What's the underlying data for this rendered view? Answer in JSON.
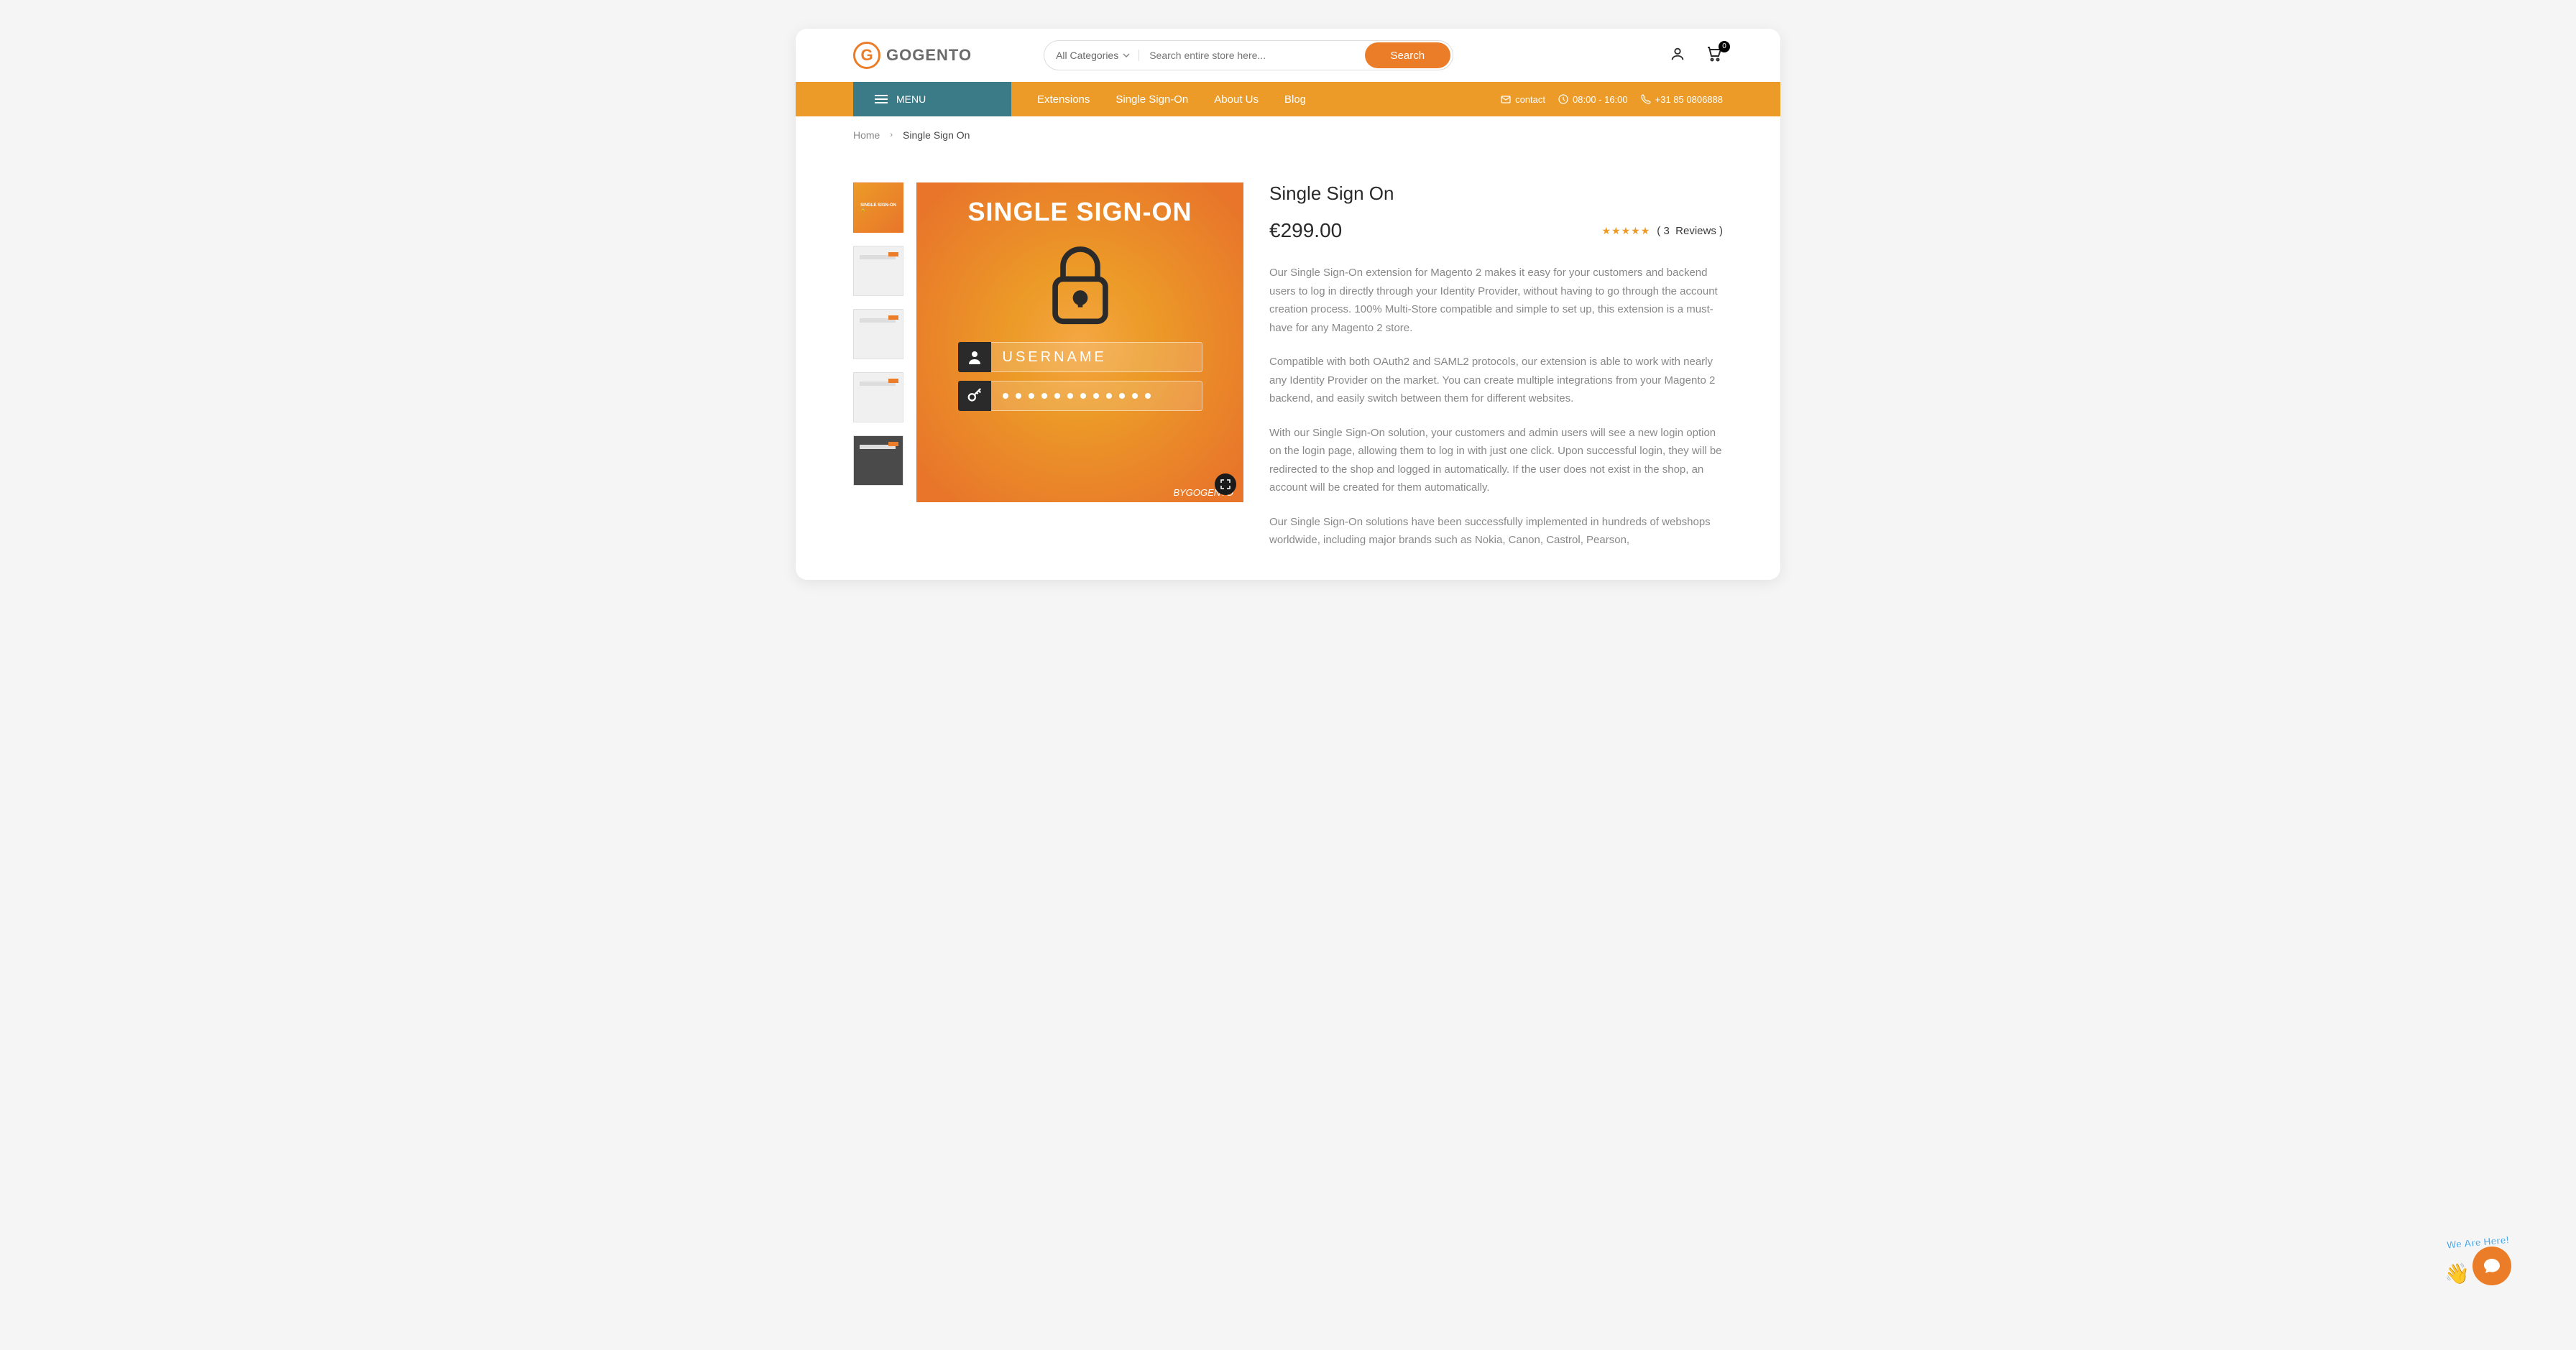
{
  "brand": {
    "name": "GOGENTO"
  },
  "header": {
    "search_category": "All Categories",
    "search_placeholder": "Search entire store here...",
    "search_button": "Search",
    "cart_count": "0"
  },
  "nav": {
    "menu_label": "MENU",
    "links": [
      "Extensions",
      "Single Sign-On",
      "About Us",
      "Blog"
    ],
    "contact_label": "contact",
    "hours": "08:00 - 16:00",
    "phone": "+31 85 0806888"
  },
  "breadcrumb": {
    "home": "Home",
    "current": "Single Sign On"
  },
  "product": {
    "main_image_title": "SINGLE SIGN-ON",
    "username_label": "USERNAME",
    "by_brand": "BYGOGENTO",
    "title": "Single Sign On",
    "price": "€299.00",
    "review_count": "3",
    "reviews_label": "Reviews",
    "descriptions": [
      "Our Single Sign-On extension for Magento 2 makes it easy for your customers and backend users to log in directly through your Identity Provider, without having to go through the account creation process. 100% Multi-Store compatible and simple to set up, this extension is a must-have for any Magento 2 store.",
      "Compatible with both OAuth2 and SAML2 protocols, our extension is able to work with nearly any Identity Provider on the market. You can create multiple integrations from your Magento 2 backend, and easily switch between them for different websites.",
      "With our Single Sign-On solution, your customers and admin users will see a new login option on the login page, allowing them to log in with just one click. Upon successful login, they will be redirected to the shop and logged in automatically. If the user does not exist in the shop, an account will be created for them automatically.",
      "Our Single Sign-On solutions have been successfully implemented in hundreds of webshops worldwide, including major brands such as Nokia, Canon, Castrol, Pearson,"
    ]
  },
  "chat": {
    "label": "We Are Here!"
  }
}
